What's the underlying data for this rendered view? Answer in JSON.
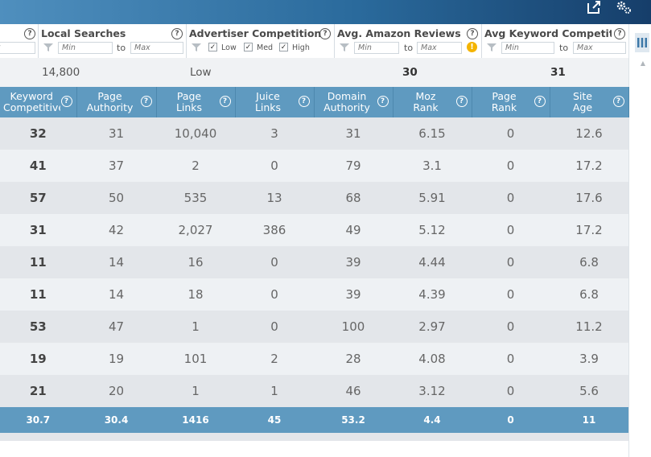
{
  "filters": {
    "local_searches": {
      "title": "Local Searches",
      "min_placeholder": "Min",
      "to": "to",
      "max_placeholder": "Max"
    },
    "advertiser_competition": {
      "title": "Advertiser Competition",
      "options": [
        "Low",
        "Med",
        "High"
      ]
    },
    "avg_amazon_reviews": {
      "title": "Avg. Amazon Reviews",
      "min_placeholder": "Min",
      "to": "to",
      "max_placeholder": "Max"
    },
    "avg_keyword_competitiveness": {
      "title": "Avg Keyword Competitiv...",
      "min_placeholder": "Min",
      "to": "to",
      "max_placeholder": "Max"
    },
    "left_partial_placeholder": "x"
  },
  "summary": {
    "local_searches": "14,800",
    "advertiser_competition": "Low",
    "avg_amazon_reviews": "30",
    "avg_keyword_competitiveness": "31"
  },
  "table": {
    "headers": [
      [
        "Keyword",
        "Competitive..."
      ],
      [
        "Page",
        "Authority"
      ],
      [
        "Page",
        "Links"
      ],
      [
        "Juice",
        "Links"
      ],
      [
        "Domain",
        "Authority"
      ],
      [
        "Moz",
        "Rank"
      ],
      [
        "Page",
        "Rank"
      ],
      [
        "Site",
        "Age"
      ]
    ],
    "rows": [
      [
        "32",
        "31",
        "10,040",
        "3",
        "31",
        "6.15",
        "0",
        "12.6"
      ],
      [
        "41",
        "37",
        "2",
        "0",
        "79",
        "3.1",
        "0",
        "17.2"
      ],
      [
        "57",
        "50",
        "535",
        "13",
        "68",
        "5.91",
        "0",
        "17.6"
      ],
      [
        "31",
        "42",
        "2,027",
        "386",
        "49",
        "5.12",
        "0",
        "17.2"
      ],
      [
        "11",
        "14",
        "16",
        "0",
        "39",
        "4.44",
        "0",
        "6.8"
      ],
      [
        "11",
        "14",
        "18",
        "0",
        "39",
        "4.39",
        "0",
        "6.8"
      ],
      [
        "53",
        "47",
        "1",
        "0",
        "100",
        "2.97",
        "0",
        "11.2"
      ],
      [
        "19",
        "19",
        "101",
        "2",
        "28",
        "4.08",
        "0",
        "3.9"
      ],
      [
        "21",
        "20",
        "1",
        "1",
        "46",
        "3.12",
        "0",
        "5.6"
      ]
    ],
    "footer": [
      "30.7",
      "30.4",
      "1416",
      "45",
      "53.2",
      "4.4",
      "0",
      "11"
    ]
  },
  "icons": {
    "export": "export-icon",
    "settings": "gears-icon",
    "columns": "columns-icon",
    "help": "?",
    "warning": "!"
  }
}
